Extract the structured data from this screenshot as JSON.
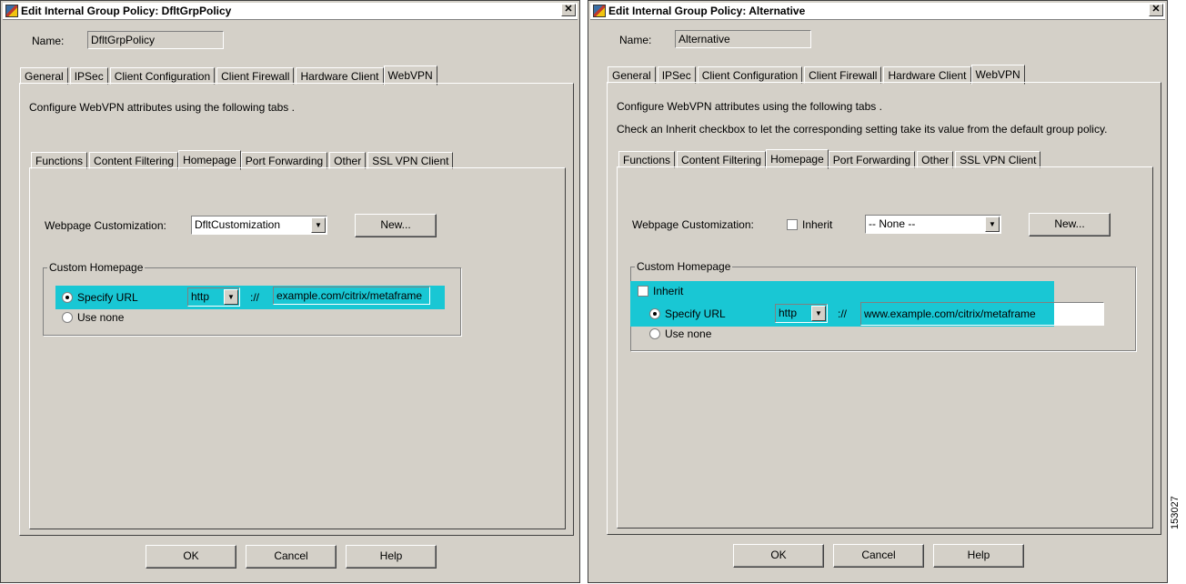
{
  "left_dialog": {
    "title": "Edit Internal Group Policy: DfltGrpPolicy",
    "name_label": "Name:",
    "name_value": "DfltGrpPolicy",
    "tabs": [
      "General",
      "IPSec",
      "Client Configuration",
      "Client Firewall",
      "Hardware Client",
      "WebVPN"
    ],
    "active_tab": "WebVPN",
    "instruction": "Configure WebVPN attributes using the following tabs .",
    "subtabs": [
      "Functions",
      "Content Filtering",
      "Homepage",
      "Port Forwarding",
      "Other",
      "SSL VPN Client"
    ],
    "active_subtab": "Homepage",
    "webpage_customization_label": "Webpage Customization:",
    "webpage_customization_value": "DfltCustomization",
    "new_button": "New...",
    "custom_homepage_title": "Custom Homepage",
    "specify_url_label": "Specify URL",
    "protocol_value": "http",
    "separator": "://",
    "url_value": "example.com/citrix/metaframe",
    "use_none_label": "Use none",
    "ok": "OK",
    "cancel": "Cancel",
    "help": "Help"
  },
  "right_dialog": {
    "title": "Edit Internal Group Policy: Alternative",
    "name_label": "Name:",
    "name_value": "Alternative",
    "tabs": [
      "General",
      "IPSec",
      "Client Configuration",
      "Client Firewall",
      "Hardware Client",
      "WebVPN"
    ],
    "active_tab": "WebVPN",
    "instruction": "Configure WebVPN attributes using the following tabs .",
    "instruction2": "Check an Inherit checkbox to let the corresponding setting take its value from the default group policy.",
    "subtabs": [
      "Functions",
      "Content Filtering",
      "Homepage",
      "Port Forwarding",
      "Other",
      "SSL VPN Client"
    ],
    "active_subtab": "Homepage",
    "webpage_customization_label": "Webpage Customization:",
    "inherit_label": "Inherit",
    "webpage_customization_value": "-- None --",
    "new_button": "New...",
    "custom_homepage_title": "Custom Homepage",
    "group_inherit_label": "Inherit",
    "specify_url_label": "Specify URL",
    "protocol_value": "http",
    "separator": "://",
    "url_value": "www.example.com/citrix/metaframe",
    "use_none_label": "Use none",
    "ok": "OK",
    "cancel": "Cancel",
    "help": "Help"
  },
  "figure_code": "153027",
  "colors": {
    "highlight": "#19c7d4",
    "dialog_bg": "#d4d0c8"
  }
}
